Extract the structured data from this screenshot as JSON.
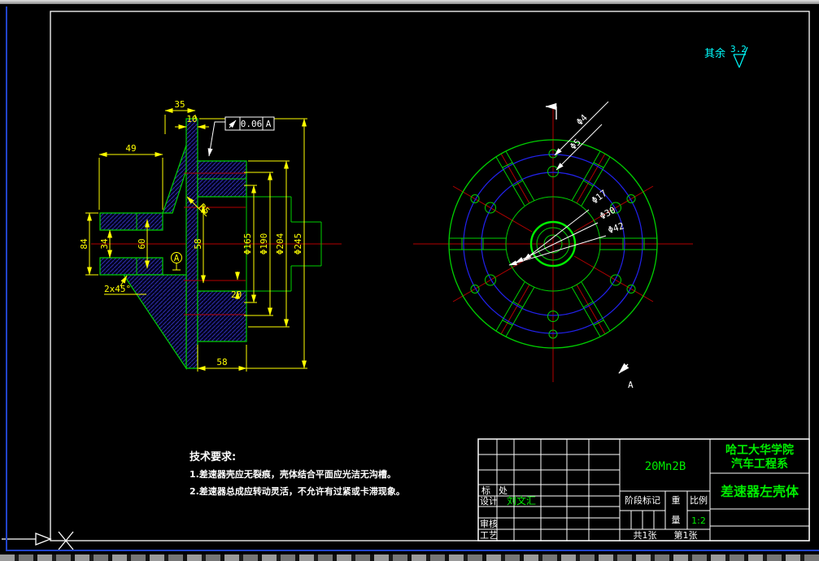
{
  "drawing": {
    "surface_note": {
      "prefix": "其余",
      "value": "3.2"
    },
    "section_view": {
      "dims": {
        "d35": "35",
        "d10": "10",
        "d49": "49",
        "r5": "R5",
        "chamfer": "2x45°",
        "d84": "84",
        "d34": "34",
        "d60": "60",
        "d58_vertical": "58",
        "d20": "20",
        "d58_horizontal": "58",
        "phi165": "Φ165",
        "phi190": "Φ190",
        "phi204": "Φ204",
        "phi245": "Φ245"
      },
      "tolerance": {
        "value": "0.06",
        "datum": "A"
      },
      "datum_label": "A"
    },
    "front_view": {
      "dims": {
        "phi4": "Φ4",
        "phi5": "Φ5",
        "phi17": "Φ17",
        "phi30": "Φ30",
        "phi42": "Φ42"
      },
      "section_letter": "A"
    },
    "tech_requirements": {
      "title": "技术要求:",
      "items": [
        "1.差速器壳应无裂痕，壳体结合平面应光洁无沟槽。",
        "2.差速器总成应转动灵活，不允许有过紧或卡滞现象。"
      ]
    },
    "title_block": {
      "material": "20Mn2B",
      "school_line1": "哈工大华学院",
      "school_line2": "汽车工程系",
      "part_name": "差速器左壳体",
      "labels": {
        "mark": "标",
        "place": "处",
        "design": "设计",
        "check": "审核",
        "process": "工艺",
        "stage": "阶段标记",
        "weight_top": "重",
        "weight_bottom": "量",
        "scale": "比例"
      },
      "designer": "刘文汇",
      "scale_value": "1:2",
      "sheet_total": "共1张",
      "sheet_no": "第1张"
    }
  }
}
